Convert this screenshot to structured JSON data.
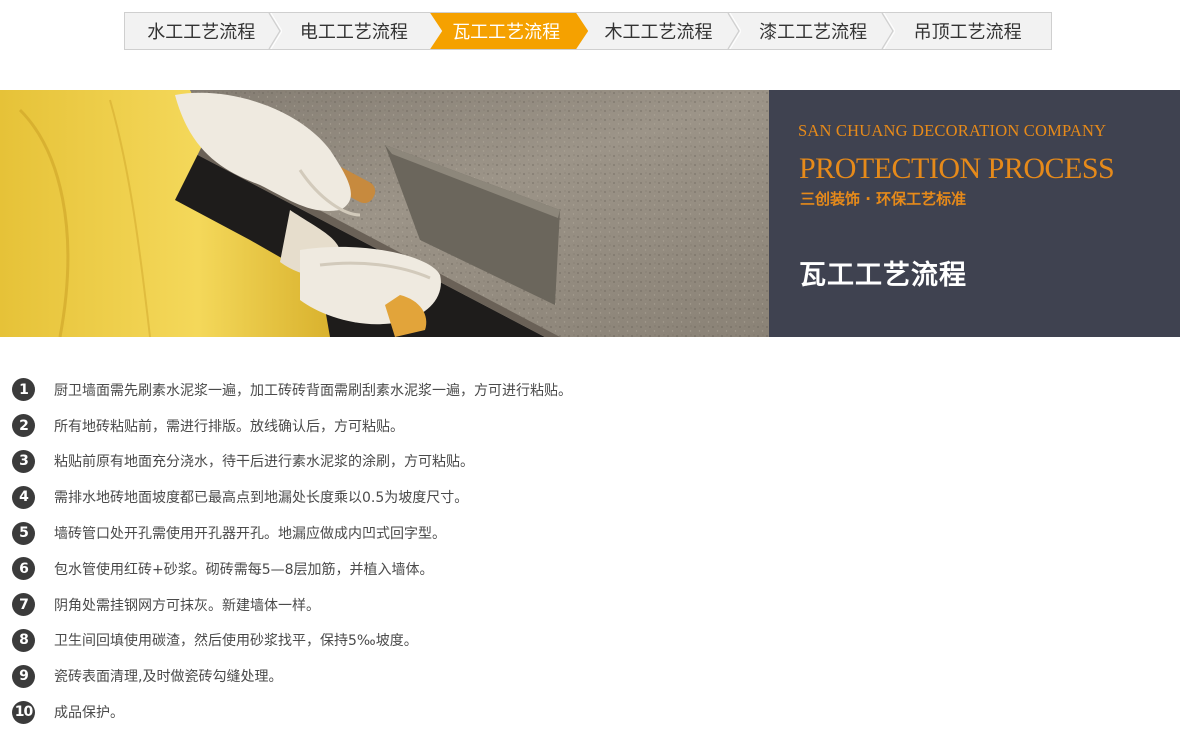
{
  "tabs": [
    {
      "label": "水工工艺流程",
      "active": false
    },
    {
      "label": "电工工艺流程",
      "active": false
    },
    {
      "label": "瓦工工艺流程",
      "active": true
    },
    {
      "label": "木工工艺流程",
      "active": false
    },
    {
      "label": "漆工工艺流程",
      "active": false
    },
    {
      "label": "吊顶工艺流程",
      "active": false
    }
  ],
  "banner": {
    "company": "SAN CHUANG DECORATION COMPANY",
    "process": "PROTECTION PROCESS",
    "slogan": "三创装饰 · 环保工艺标准",
    "title": "瓦工工艺流程"
  },
  "steps": [
    {
      "num": "1",
      "text": "厨卫墙面需先刷素水泥浆一遍，加工砖砖背面需刷刮素水泥浆一遍，方可进行粘贴。"
    },
    {
      "num": "2",
      "text": "所有地砖粘贴前，需进行排版。放线确认后，方可粘贴。"
    },
    {
      "num": "3",
      "text": "粘贴前原有地面充分浇水，待干后进行素水泥浆的涂刷，方可粘贴。"
    },
    {
      "num": "4",
      "text": "需排水地砖地面坡度都已最高点到地漏处长度乘以0.5为坡度尺寸。"
    },
    {
      "num": "5",
      "text": "墙砖管口处开孔需使用开孔器开孔。地漏应做成内凹式回字型。"
    },
    {
      "num": "6",
      "text": "包水管使用红砖+砂浆。砌砖需每5—8层加筋，并植入墙体。"
    },
    {
      "num": "7",
      "text": "阴角处需挂钢网方可抹灰。新建墙体一样。"
    },
    {
      "num": "8",
      "text": "卫生间回填使用碳渣，然后使用砂浆找平，保持5‰坡度。"
    },
    {
      "num": "9",
      "text": "瓷砖表面清理,及时做瓷砖勾缝处理。"
    },
    {
      "num": "10",
      "text": "成品保护。"
    }
  ],
  "colors": {
    "accent": "#f5a100",
    "panel_bg": "#3f4250",
    "panel_text": "#e68a1a"
  }
}
